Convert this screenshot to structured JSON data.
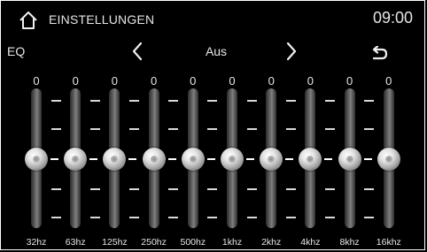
{
  "header": {
    "title": "EINSTELLUNGEN",
    "time": "09:00"
  },
  "eq": {
    "label": "EQ",
    "preset": "Aus",
    "bands": [
      {
        "freq": "32hz",
        "value": "0"
      },
      {
        "freq": "63hz",
        "value": "0"
      },
      {
        "freq": "125hz",
        "value": "0"
      },
      {
        "freq": "250hz",
        "value": "0"
      },
      {
        "freq": "500hz",
        "value": "0"
      },
      {
        "freq": "1khz",
        "value": "0"
      },
      {
        "freq": "2khz",
        "value": "0"
      },
      {
        "freq": "4khz",
        "value": "0"
      },
      {
        "freq": "8khz",
        "value": "0"
      },
      {
        "freq": "16khz",
        "value": "0"
      }
    ]
  },
  "icons": {
    "home": "home-icon",
    "previous": "chevron-left-icon",
    "next": "chevron-right-icon",
    "back": "back-icon"
  }
}
